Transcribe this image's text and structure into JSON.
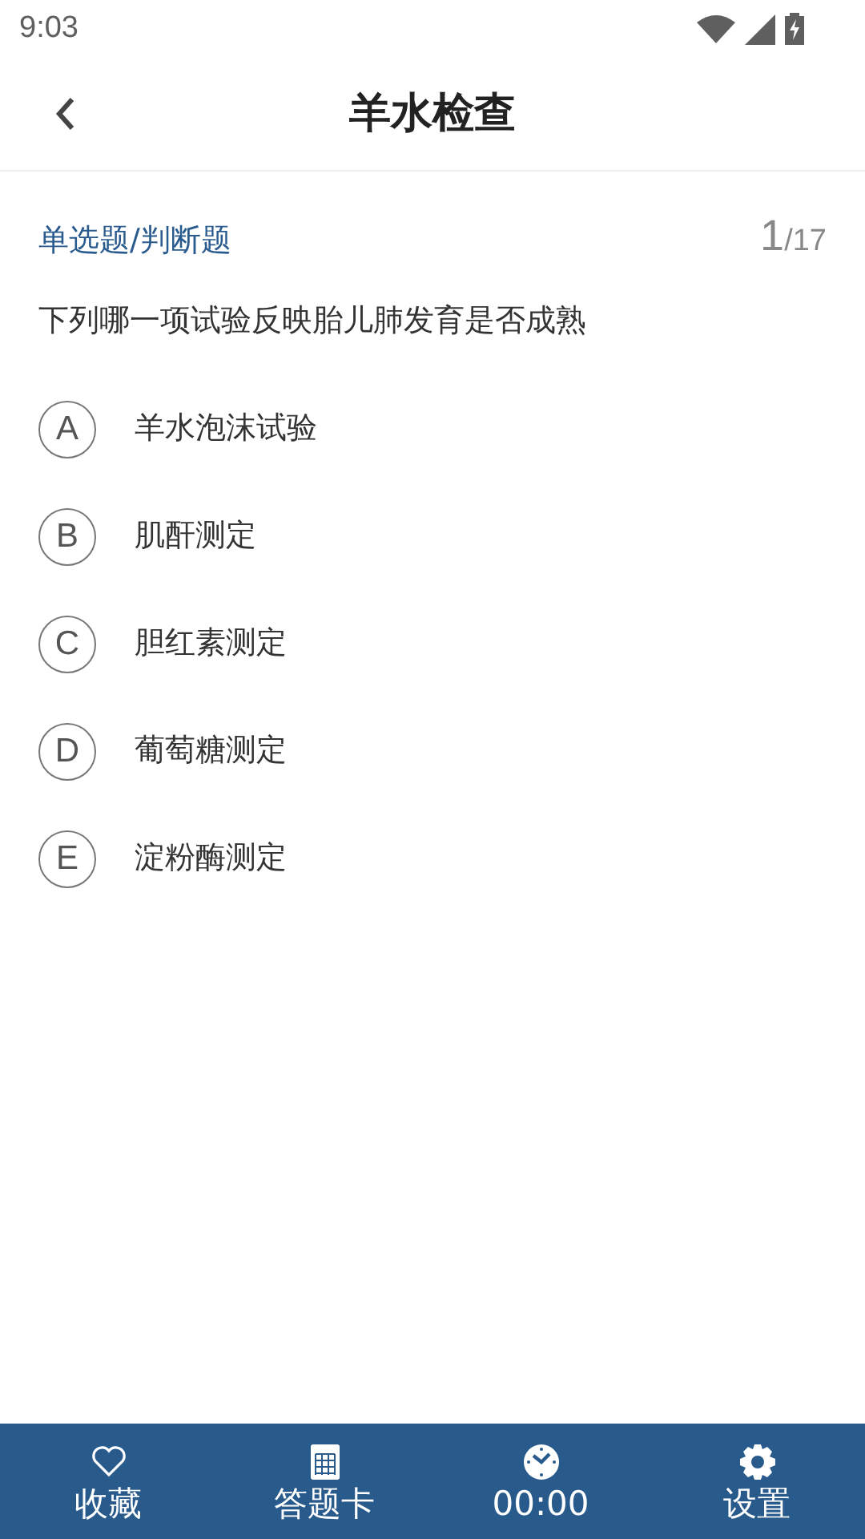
{
  "status_bar": {
    "time": "9:03"
  },
  "header": {
    "title": "羊水检查"
  },
  "question": {
    "type_label": "单选题/判断题",
    "current": "1",
    "total": "/17",
    "text": "下列哪一项试验反映胎儿肺发育是否成熟",
    "options": [
      {
        "letter": "A",
        "text": "羊水泡沫试验",
        "selected": false
      },
      {
        "letter": "B",
        "text": "肌酐测定",
        "selected": false
      },
      {
        "letter": "C",
        "text": "胆红素测定",
        "selected": false
      },
      {
        "letter": "D",
        "text": "葡萄糖测定",
        "selected": false
      },
      {
        "letter": "E",
        "text": "淀粉酶测定",
        "selected": false
      }
    ]
  },
  "bottom_bar": [
    {
      "kind": "heart",
      "label": "收藏"
    },
    {
      "kind": "grid",
      "label": "答题卡"
    },
    {
      "kind": "clock",
      "label": "00:00"
    },
    {
      "kind": "gear",
      "label": "设置"
    }
  ]
}
